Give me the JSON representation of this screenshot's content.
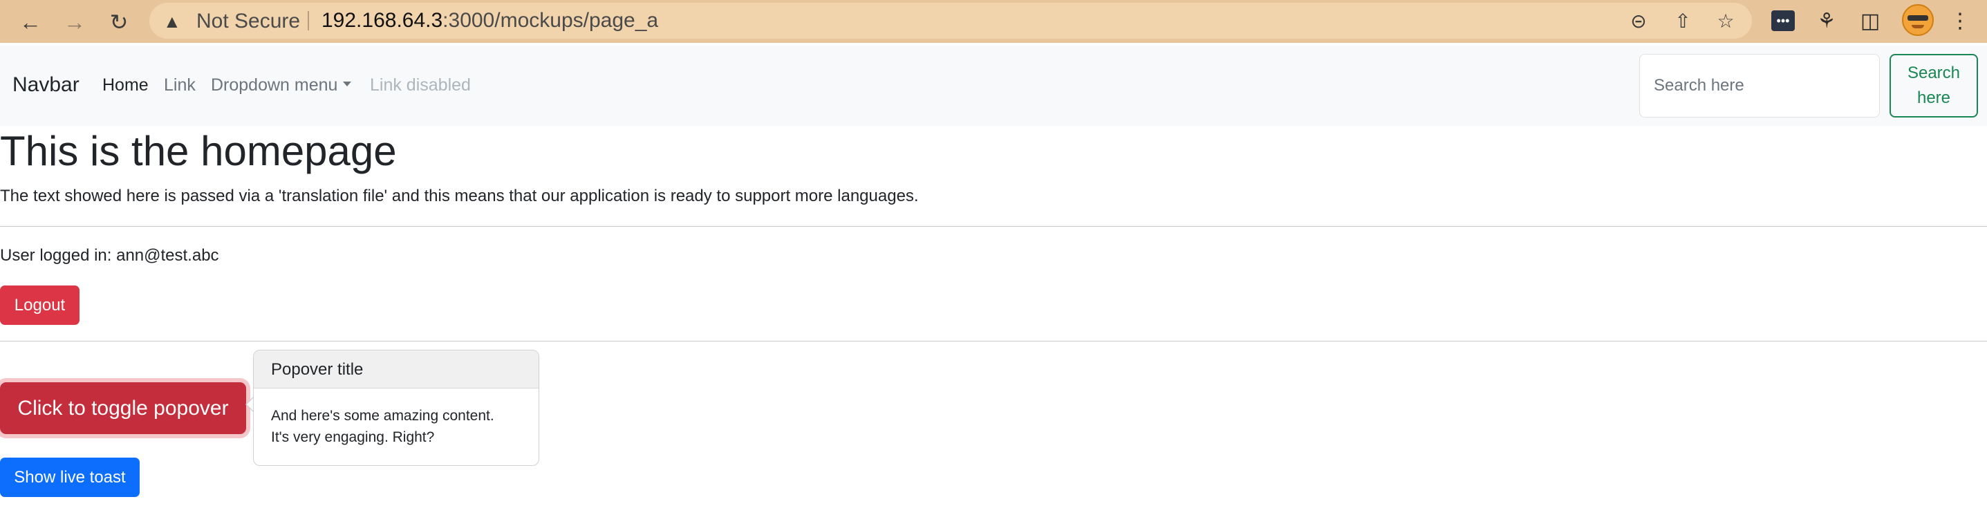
{
  "browser": {
    "security_label": "Not Secure",
    "url_host": "192.168.64.3",
    "url_path": ":3000/mockups/page_a",
    "icons": {
      "back": "arrow-left-icon",
      "forward": "arrow-right-icon",
      "reload": "reload-icon",
      "warning": "warning-triangle-icon",
      "zoom": "zoom-out-icon",
      "share": "share-icon",
      "bookmark": "star-icon",
      "extension": "password-manager-icon",
      "extensions": "puzzle-icon",
      "sidepanel": "side-panel-icon",
      "menu": "kebab-menu-icon"
    }
  },
  "navbar": {
    "brand": "Navbar",
    "links": [
      {
        "label": "Home",
        "state": "active"
      },
      {
        "label": "Link",
        "state": "normal"
      },
      {
        "label": "Dropdown menu",
        "state": "dropdown"
      },
      {
        "label": "Link disabled",
        "state": "disabled"
      }
    ],
    "search": {
      "placeholder": "Search here",
      "value": "",
      "button_label_line1": "Search",
      "button_label_line2": "here"
    }
  },
  "main": {
    "title": "This is the homepage",
    "lead": "The text showed here is passed via a 'translation file' and this means that our application is ready to support more languages.",
    "user_line": "User logged in: ann@test.abc",
    "logout_label": "Logout",
    "popover_button_label": "Click to toggle popover",
    "popover": {
      "title": "Popover title",
      "body_line1": "And here's some amazing content.",
      "body_line2": "It's very engaging. Right?"
    },
    "toast_button_label": "Show live toast"
  },
  "colors": {
    "chrome": "#e7c49a",
    "danger": "#dc3545",
    "primary": "#0d6efd",
    "success": "#198754",
    "navbar_bg": "#f8f9fa"
  }
}
